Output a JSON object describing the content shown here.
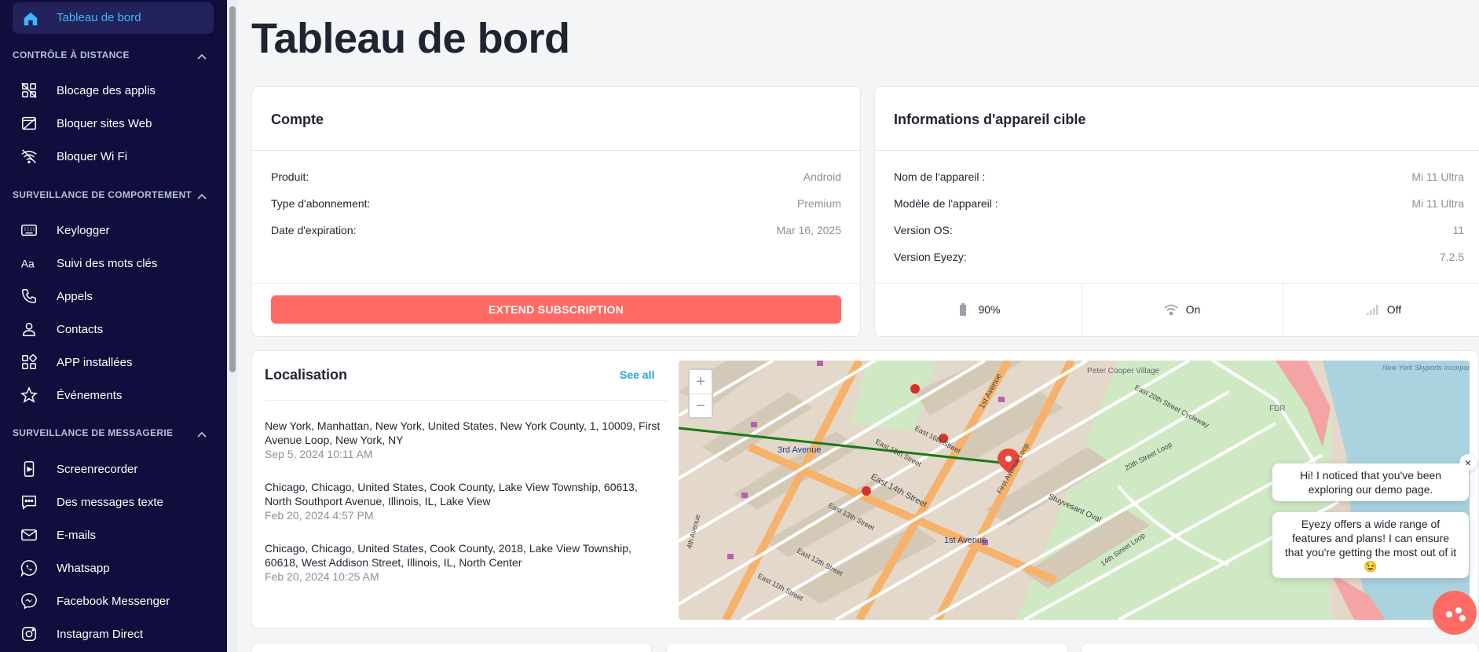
{
  "sidebar": {
    "active": {
      "label": "Tableau de bord",
      "icon": "home-icon"
    },
    "sections": [
      {
        "title": "CONTRÔLE À DISTANCE",
        "items": [
          {
            "label": "Blocage des applis",
            "icon": "app-block-icon"
          },
          {
            "label": "Bloquer sites Web",
            "icon": "web-block-icon"
          },
          {
            "label": "Bloquer Wi Fi",
            "icon": "wifi-off-icon"
          }
        ]
      },
      {
        "title": "SURVEILLANCE DE COMPORTEMENT",
        "items": [
          {
            "label": "Keylogger",
            "icon": "keyboard-icon"
          },
          {
            "label": "Suivi des mots clés",
            "icon": "text-aa-icon"
          },
          {
            "label": "Appels",
            "icon": "phone-icon"
          },
          {
            "label": "Contacts",
            "icon": "user-icon"
          },
          {
            "label": "APP installées",
            "icon": "apps-grid-icon"
          },
          {
            "label": "Événements",
            "icon": "star-icon"
          }
        ]
      },
      {
        "title": "SURVEILLANCE DE MESSAGERIE",
        "items": [
          {
            "label": "Screenrecorder",
            "icon": "screen-record-icon"
          },
          {
            "label": "Des messages texte",
            "icon": "message-icon"
          },
          {
            "label": "E-mails",
            "icon": "mail-icon"
          },
          {
            "label": "Whatsapp",
            "icon": "whatsapp-icon"
          },
          {
            "label": "Facebook Messenger",
            "icon": "messenger-icon"
          },
          {
            "label": "Instagram Direct",
            "icon": "instagram-icon"
          }
        ]
      }
    ]
  },
  "page": {
    "title": "Tableau de bord"
  },
  "account": {
    "title": "Compte",
    "rows": [
      {
        "label": "Produit:",
        "value": "Android"
      },
      {
        "label": "Type d'abonnement:",
        "value": "Premium"
      },
      {
        "label": "Date d'expiration:",
        "value": "Mar 16, 2025"
      }
    ],
    "button_label": "EXTEND SUBSCRIPTION"
  },
  "device": {
    "title": "Informations d'appareil cible",
    "rows": [
      {
        "label": "Nom de l'appareil :",
        "value": "Mi 11 Ultra"
      },
      {
        "label": "Modèle de l'appareil :",
        "value": "Mi 11 Ultra"
      },
      {
        "label": "Version OS:",
        "value": "11"
      },
      {
        "label": "Version Eyezy:",
        "value": "7.2.5"
      }
    ],
    "status": {
      "battery": "90%",
      "wifi": "On",
      "signal": "Off"
    }
  },
  "location": {
    "title": "Localisation",
    "see_all": "See all",
    "entries": [
      {
        "address": "New York, Manhattan, New York, United States, New York County, 1, 10009, First Avenue Loop, New York, NY",
        "time": "Sep 5, 2024 10:11 AM"
      },
      {
        "address": "Chicago, Chicago, United States, Cook County, Lake View Township, 60613, North Southport Avenue, Illinois, IL, Lake View",
        "time": "Feb 20, 2024 4:57 PM"
      },
      {
        "address": "Chicago, Chicago, United States, Cook County, 2018, Lake View Township, 60618, West Addison Street, Illinois, IL, North Center",
        "time": "Feb 20, 2024 10:25 AM"
      }
    ]
  },
  "map": {
    "zoom_in": "+",
    "zoom_out": "−",
    "labels": {
      "third_avenue": "3rd Avenue",
      "east_14th": "East 14th Street",
      "first_avenue": "1st Avenue",
      "first_ave_north": "1st Avenue",
      "peter_cooper": "Peter Cooper Village",
      "stuyvesant_oval": "Stuyvesant Oval",
      "seaplane": "New York Skyports Incorporated Seaplane Base",
      "fdr": "FDR",
      "east_16th": "East 16th Street",
      "east_15th": "East 15th Street",
      "east_20th": "East 20th Street Cycleway",
      "fourth_avenue": "4th Avenue",
      "east_13th": "East 13th Street",
      "east_12th": "East 12th Street",
      "east_11th": "East 11th Street",
      "fourteenth_loop": "14th Street Loop",
      "twentieth_loop": "20th Street Loop",
      "first_ave_loop": "First Avenue Loop"
    }
  },
  "chat": {
    "message_1": "Hi! I noticed that you've been exploring our demo page.",
    "message_2": "Eyezy offers a wide range of features and plans! I can ensure that you're getting the most out of it 😉",
    "close": "×"
  },
  "colors": {
    "sidebar_bg": "#0f0e3d",
    "accent": "#3db7ff",
    "cta": "#ff6b64",
    "link": "#1ea3e0"
  }
}
